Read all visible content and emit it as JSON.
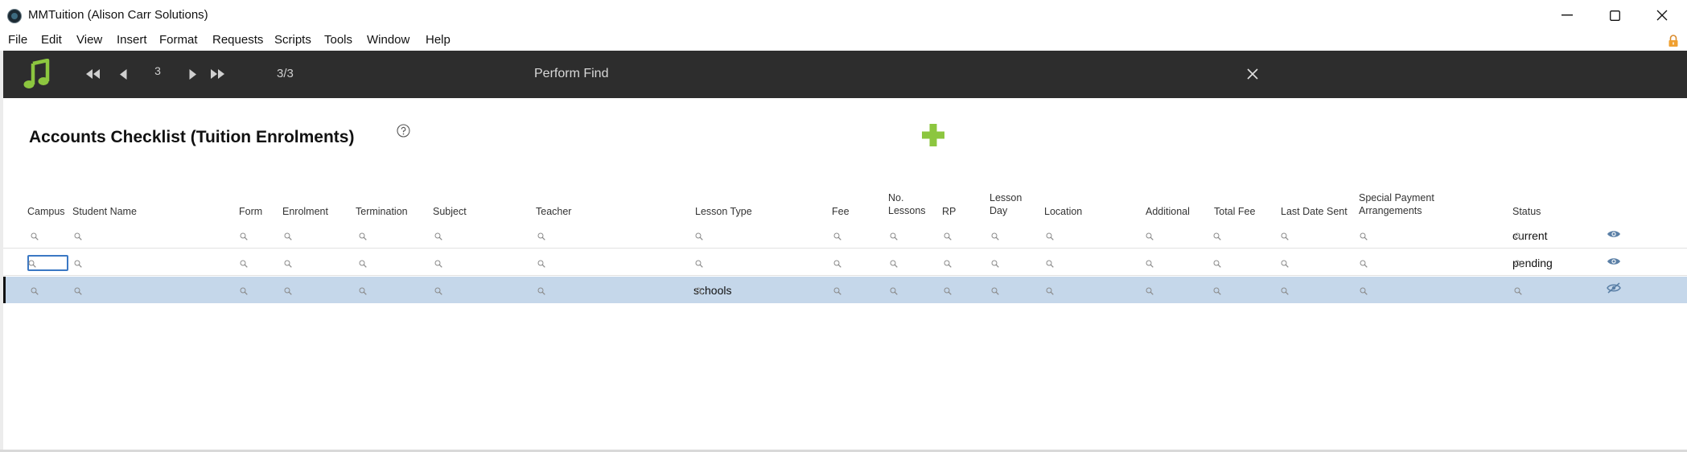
{
  "window": {
    "title": "MMTuition (Alison Carr Solutions)",
    "minimize_icon": "minimize-icon",
    "maximize_icon": "maximize-icon",
    "close_icon": "close-icon"
  },
  "menu": [
    "File",
    "Edit",
    "View",
    "Insert",
    "Format",
    "Requests",
    "Scripts",
    "Tools",
    "Window",
    "Help"
  ],
  "toolbar": {
    "logo_icon": "music-note-icon",
    "record_number": "3",
    "found_count": "3/3",
    "mode_label": "Perform Find"
  },
  "layout": {
    "title": "Accounts Checklist (Tuition Enrolments)"
  },
  "columns": [
    {
      "line1": "",
      "line2": "Campus"
    },
    {
      "line1": "",
      "line2": "Student Name"
    },
    {
      "line1": "",
      "line2": "Form"
    },
    {
      "line1": "",
      "line2": "Enrolment"
    },
    {
      "line1": "",
      "line2": "Termination"
    },
    {
      "line1": "",
      "line2": "Subject"
    },
    {
      "line1": "",
      "line2": "Teacher"
    },
    {
      "line1": "",
      "line2": "Lesson Type"
    },
    {
      "line1": "",
      "line2": "Fee"
    },
    {
      "line1": "No.",
      "line2": "Lessons"
    },
    {
      "line1": "",
      "line2": "RP"
    },
    {
      "line1": "Lesson",
      "line2": "Day"
    },
    {
      "line1": "",
      "line2": "Location"
    },
    {
      "line1": "",
      "line2": "Additional"
    },
    {
      "line1": "",
      "line2": "Total Fee"
    },
    {
      "line1": "",
      "line2": "Last Date Sent"
    },
    {
      "line1": "Special Payment",
      "line2": "Arrangements"
    },
    {
      "line1": "",
      "line2": "Status"
    }
  ],
  "rows": [
    {
      "lesson_type": "",
      "status": "current",
      "omit": false
    },
    {
      "lesson_type": "",
      "status": "pending",
      "omit": false
    },
    {
      "lesson_type": "schools",
      "status": "",
      "omit": true
    }
  ]
}
